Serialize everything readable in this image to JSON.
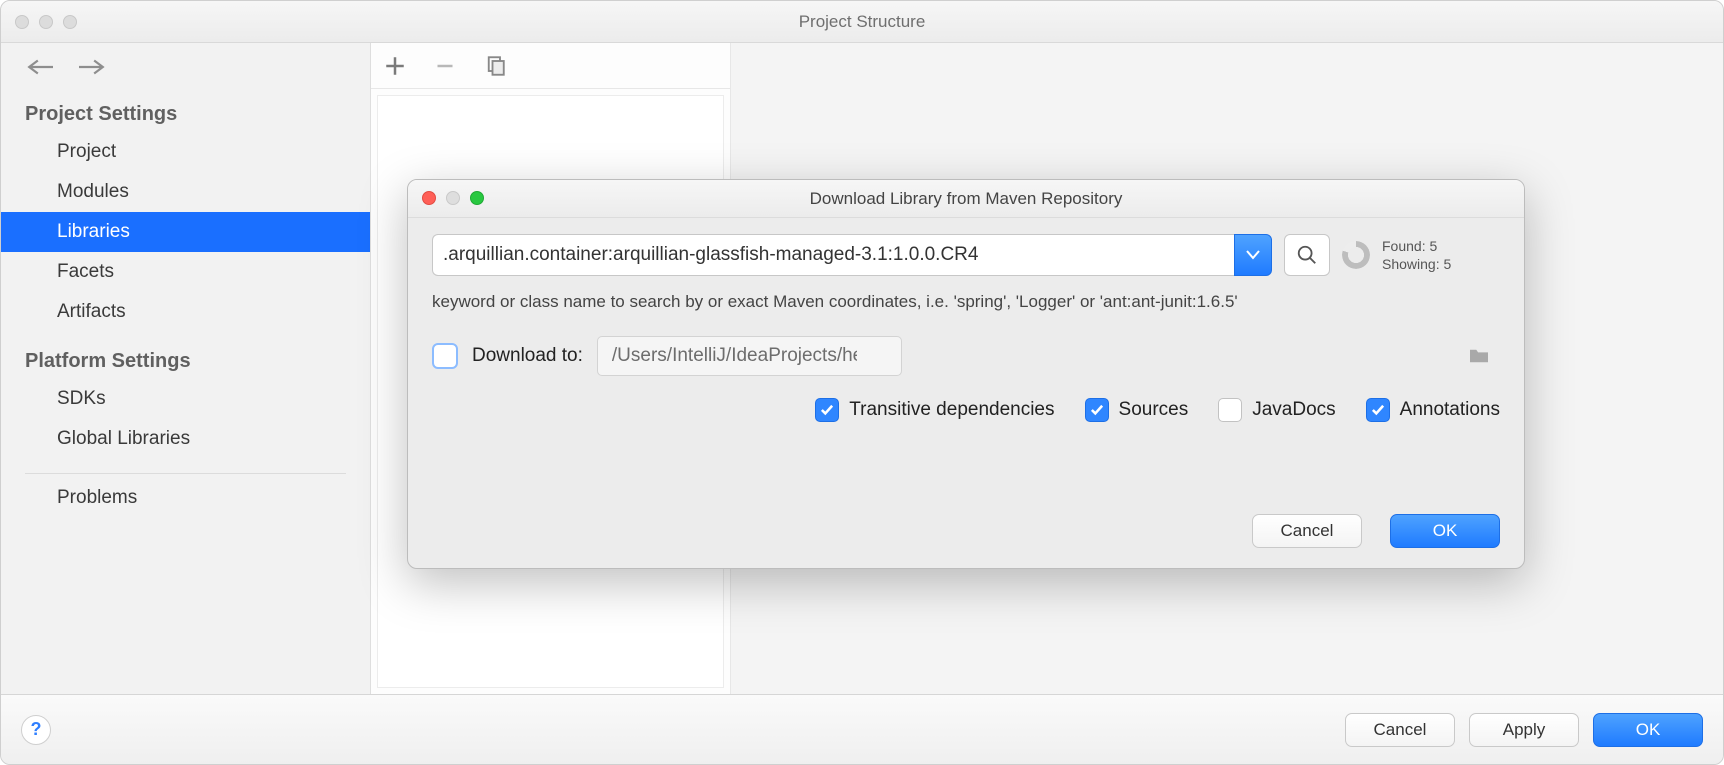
{
  "main_window": {
    "title": "Project Structure",
    "footer": {
      "cancel": "Cancel",
      "apply": "Apply",
      "ok": "OK"
    }
  },
  "sidebar": {
    "groups": [
      {
        "header": "Project Settings",
        "items": [
          {
            "id": "project",
            "label": "Project"
          },
          {
            "id": "modules",
            "label": "Modules"
          },
          {
            "id": "libraries",
            "label": "Libraries",
            "selected": true
          },
          {
            "id": "facets",
            "label": "Facets"
          },
          {
            "id": "artifacts",
            "label": "Artifacts"
          }
        ]
      },
      {
        "header": "Platform Settings",
        "items": [
          {
            "id": "sdks",
            "label": "SDKs"
          },
          {
            "id": "global-libraries",
            "label": "Global Libraries"
          }
        ]
      }
    ],
    "bottom_item": {
      "id": "problems",
      "label": "Problems"
    }
  },
  "modal": {
    "title": "Download Library from Maven Repository",
    "search_value": ".arquillian.container:arquillian-glassfish-managed-3.1:1.0.0.CR4",
    "counts": {
      "found_label": "Found:",
      "found": 5,
      "showing_label": "Showing:",
      "showing": 5
    },
    "hint": "keyword or class name to search by or exact Maven coordinates, i.e. 'spring', 'Logger' or 'ant:ant-junit:1.6.5'",
    "download_to": {
      "label": "Download to:",
      "checked": false,
      "path": "/Users/IntelliJ/IdeaProjects/helloWorld/lib"
    },
    "options": {
      "transitive": {
        "label": "Transitive dependencies",
        "checked": true
      },
      "sources": {
        "label": "Sources",
        "checked": true
      },
      "javadocs": {
        "label": "JavaDocs",
        "checked": false
      },
      "annotations": {
        "label": "Annotations",
        "checked": true
      }
    },
    "footer": {
      "cancel": "Cancel",
      "ok": "OK"
    }
  }
}
